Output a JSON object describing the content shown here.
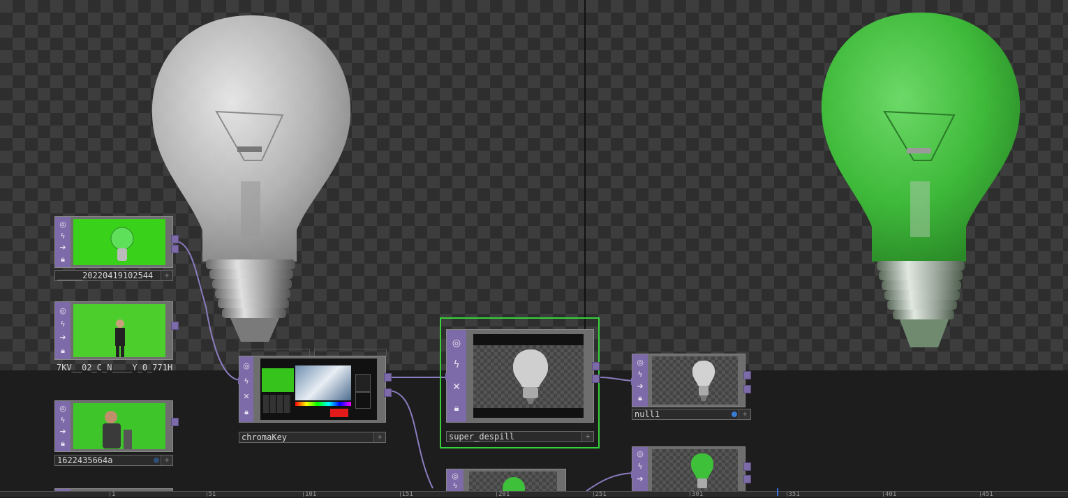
{
  "viewers": {
    "left": {
      "name": "viewer-chromakey-output"
    },
    "right": {
      "name": "viewer-null-output"
    }
  },
  "nodes": {
    "movie1": {
      "label": "_____20220419102544"
    },
    "movie2": {
      "label": "7KV__02_C_N____Y_0_771H"
    },
    "movie3": {
      "label": "1622435664a"
    },
    "chromakey": {
      "label": "chromaKey"
    },
    "super_despill": {
      "label": "super_despill"
    },
    "null1": {
      "label": "null1"
    }
  },
  "timeline": {
    "ticks": [
      "1",
      "51",
      "101",
      "151",
      "201",
      "251",
      "301",
      "351",
      "401",
      "451"
    ]
  },
  "colors": {
    "flag_bar": "#7d6aa8",
    "selection": "#36d13a",
    "green_screen": "#39d11a",
    "bulb_green": "#3fc03a",
    "playhead": "#3a6ed8"
  },
  "icons": {
    "viewer_flag": "eye-icon",
    "cook_flag": "lightning-icon",
    "bypass_flag": "x-icon",
    "lock_flag": "lock-icon",
    "display_flag": "arrow-icon",
    "add_button": "plus-icon"
  }
}
